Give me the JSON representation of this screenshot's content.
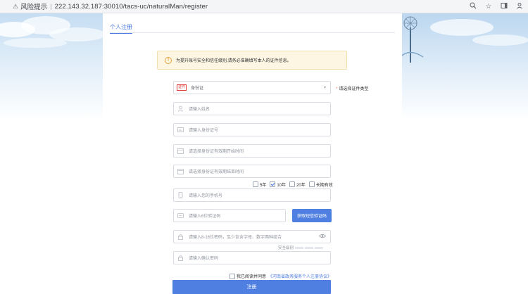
{
  "browser": {
    "risk_label": "风险提示",
    "url": "222.143.32.187:30010/tacs-uc/naturalMan/register"
  },
  "tab": {
    "title": "个人注册"
  },
  "notice": {
    "text": "为提升账号安全和信任级别,请务必准确填写本人的证件信息。"
  },
  "form": {
    "id_type": {
      "badge": "证件",
      "value": "身份证",
      "hint_star": "*",
      "hint": "请选择证件类型"
    },
    "name_placeholder": "请输入姓名",
    "id_number_placeholder": "请输入身份证号",
    "valid_start_placeholder": "请选择身份证有效期开始时间",
    "valid_end_placeholder": "请选择身份证有效期结束时间",
    "validity_options": [
      {
        "label": "5年",
        "checked": false
      },
      {
        "label": "10年",
        "checked": true
      },
      {
        "label": "20年",
        "checked": false
      },
      {
        "label": "长期有效",
        "checked": false
      }
    ],
    "phone_placeholder": "请输入您的手机号",
    "sms_placeholder": "请输入6位验证码",
    "sms_button": "获取短信验证码",
    "password_placeholder": "请输入8-16位密码，至少包含字母、数字两种组合",
    "strength_label": "安全级别",
    "confirm_password_placeholder": "请输入确认密码",
    "agree_prefix": "我已阅读并同意",
    "agree_link": "《河南省政务服务个人注册协议》",
    "submit_label": "注册"
  },
  "colors": {
    "primary": "#4f7fe0",
    "warning": "#e6a23c",
    "danger": "#f56c6c",
    "notice_bg": "#fdf6e3"
  }
}
